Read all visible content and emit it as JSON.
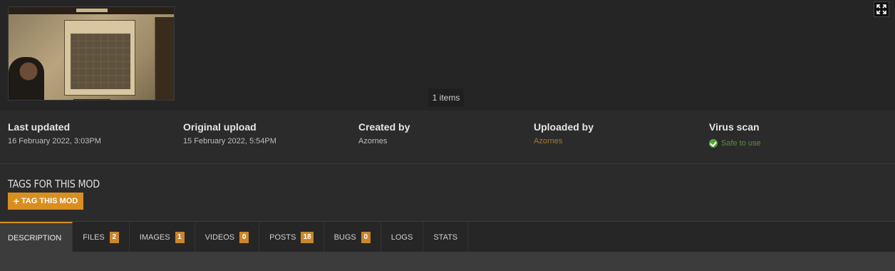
{
  "gallery": {
    "items_count": "1 items"
  },
  "stats": {
    "last_updated": {
      "label": "Last updated",
      "value": "16 February 2022,  3:03PM"
    },
    "original_upload": {
      "label": "Original upload",
      "value": "15 February 2022,  5:54PM"
    },
    "created_by": {
      "label": "Created by",
      "value": "Azornes"
    },
    "uploaded_by": {
      "label": "Uploaded by",
      "value": "Azornes"
    },
    "virus_scan": {
      "label": "Virus scan",
      "value": "Safe to use",
      "icon": "check-circle-icon",
      "color": "#57a33a"
    }
  },
  "tags": {
    "heading": "TAGS FOR THIS MOD",
    "button_label": "TAG THIS MOD",
    "button_icon": "plus-icon",
    "button_color": "#d98f20"
  },
  "tabs": [
    {
      "label": "DESCRIPTION",
      "badge": ""
    },
    {
      "label": "FILES",
      "badge": "2"
    },
    {
      "label": "IMAGES",
      "badge": "1"
    },
    {
      "label": "VIDEOS",
      "badge": "0"
    },
    {
      "label": "POSTS",
      "badge": "18"
    },
    {
      "label": "BUGS",
      "badge": "0"
    },
    {
      "label": "LOGS",
      "badge": ""
    },
    {
      "label": "STATS",
      "badge": ""
    }
  ],
  "colors": {
    "accent": "#d98f20",
    "link": "#a57a2c",
    "background": "#2b2b2b"
  }
}
